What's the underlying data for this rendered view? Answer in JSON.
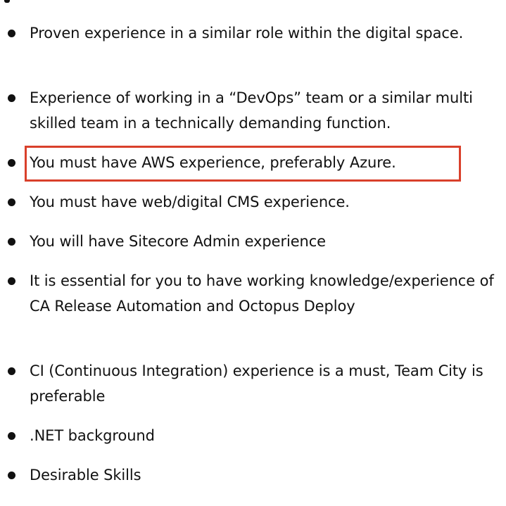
{
  "requirements": [
    {
      "text": "Proven experience in a similar role within the digital space."
    },
    {
      "text": "Experience of working in a “DevOps” team or a similar multi skilled team in a technically demanding function."
    },
    {
      "text": "You must have AWS experience, preferably Azure."
    },
    {
      "text": "You must have web/digital CMS experience."
    },
    {
      "text": "You will have Sitecore Admin experience"
    },
    {
      "text": "It is essential for you to have working knowledge/experience of CA Release Automation and Octopus Deploy"
    },
    {
      "text": "CI (Continuous Integration) experience is a must, Team City is preferable"
    },
    {
      "text": ".NET background"
    },
    {
      "text": "Desirable Skills"
    }
  ],
  "highlight": {
    "item": 2,
    "color": "#d9402b"
  },
  "colors": {
    "text": "#111111",
    "background": "#ffffff"
  }
}
